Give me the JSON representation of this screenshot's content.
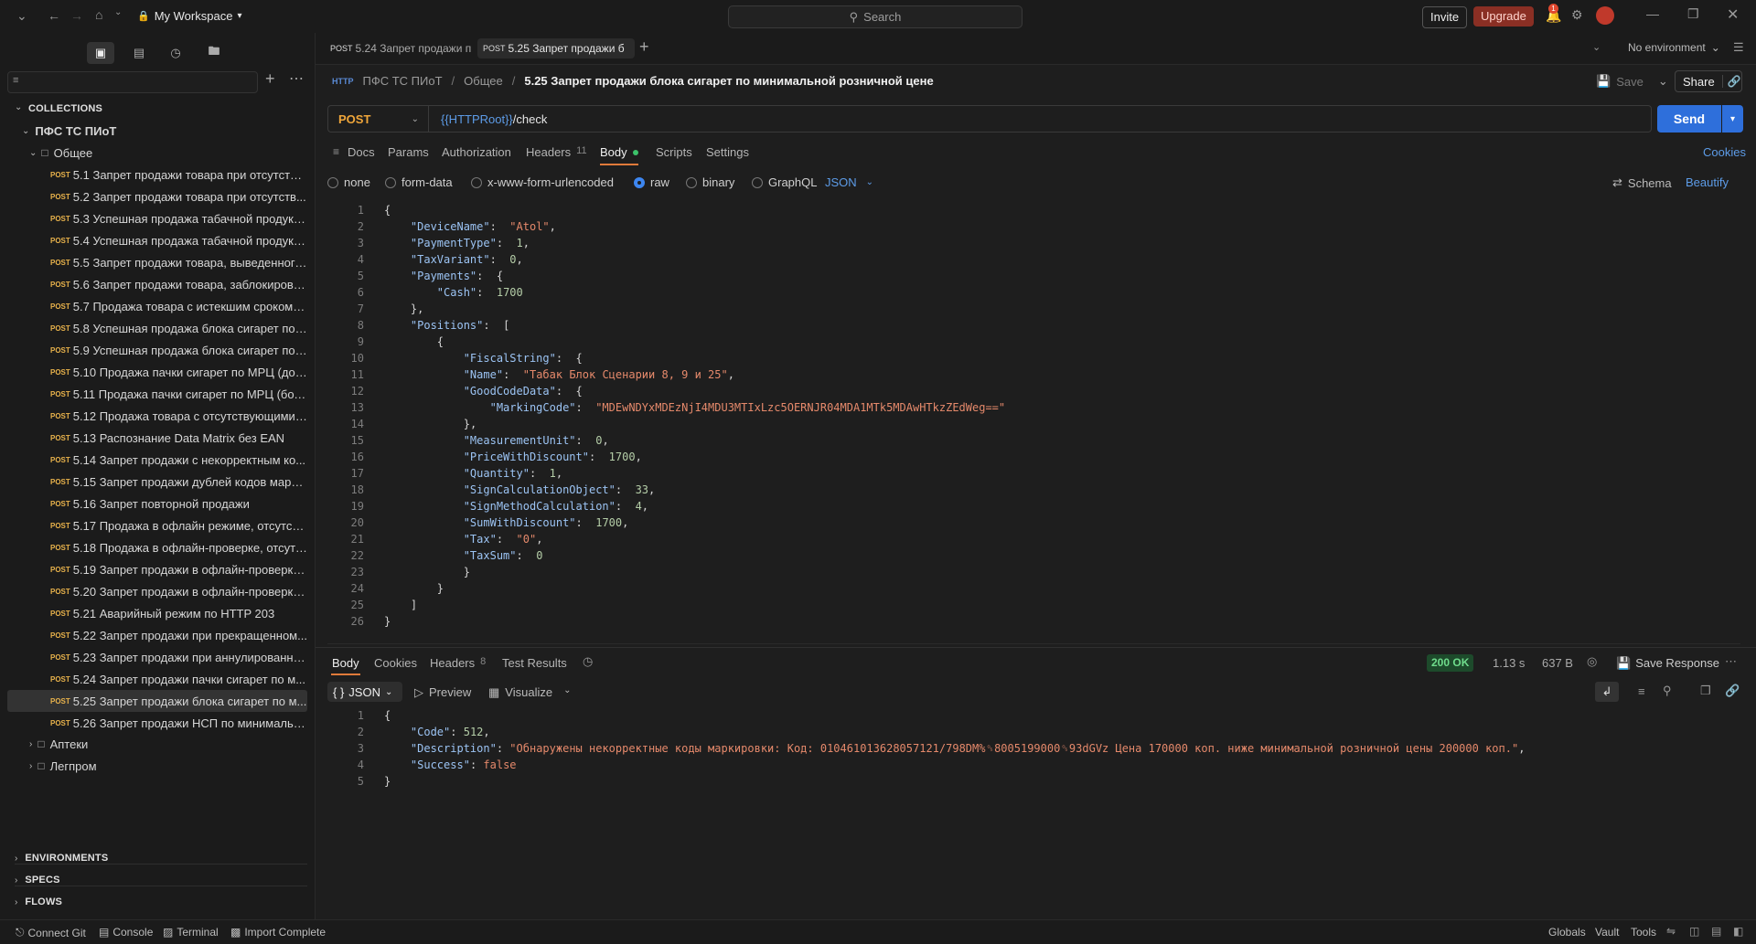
{
  "titlebar": {
    "workspace": "My Workspace",
    "search_placeholder": "Search",
    "invite_label": "Invite",
    "upgrade_label": "Upgrade",
    "notification_count": "1"
  },
  "sidebar": {
    "collections_label": "COLLECTIONS",
    "collection_name": "ПФС ТС ПИоТ",
    "folder_name": "Общее",
    "requests": [
      {
        "method": "POST",
        "name": "5.1 Запрет продажи товара при отсутстви..."
      },
      {
        "method": "POST",
        "name": "5.2 Запрет продажи товара при отсутств..."
      },
      {
        "method": "POST",
        "name": "5.3 Успешная продажа табачной продукц..."
      },
      {
        "method": "POST",
        "name": "5.4 Успешная продажа табачной продукц..."
      },
      {
        "method": "POST",
        "name": "5.5 Запрет продажи товара, выведенного..."
      },
      {
        "method": "POST",
        "name": "5.6 Запрет продажи товара, заблокирова..."
      },
      {
        "method": "POST",
        "name": "5.7 Продажа товара с истекшим сроком г..."
      },
      {
        "method": "POST",
        "name": "5.8 Успешная продажа блока сигарет по ..."
      },
      {
        "method": "POST",
        "name": "5.9 Успешная продажа блока сигарет по ..."
      },
      {
        "method": "POST",
        "name": "5.10 Продажа пачки сигарет по МРЦ (до 1..."
      },
      {
        "method": "POST",
        "name": "5.11 Продажа пачки сигарет по МРЦ (бол..."
      },
      {
        "method": "POST",
        "name": "5.12 Продажа товара с отсутствующими ..."
      },
      {
        "method": "POST",
        "name": "5.13 Распознание Data Matrix без EAN"
      },
      {
        "method": "POST",
        "name": "5.14 Запрет продажи с некорректным ко..."
      },
      {
        "method": "POST",
        "name": "5.15 Запрет продажи дублей кодов марки..."
      },
      {
        "method": "POST",
        "name": "5.16 Запрет повторной продажи"
      },
      {
        "method": "POST",
        "name": "5.17 Продажа в офлайн режиме, отсутств..."
      },
      {
        "method": "POST",
        "name": "5.18 Продажа в офлайн-проверке, отсутс..."
      },
      {
        "method": "POST",
        "name": "5.19 Запрет продажи в офлайн-проверке,..."
      },
      {
        "method": "POST",
        "name": "5.20 Запрет продажи в офлайн-проверке ..."
      },
      {
        "method": "POST",
        "name": "5.21 Аварийный режим по HTTP 203"
      },
      {
        "method": "POST",
        "name": "5.22 Запрет продажи при прекращенном..."
      },
      {
        "method": "POST",
        "name": "5.23 Запрет продажи при аннулированно..."
      },
      {
        "method": "POST",
        "name": "5.24 Запрет продажи пачки сигарет по м..."
      },
      {
        "method": "POST",
        "name": "5.25 Запрет продажи блока сигарет по м..."
      },
      {
        "method": "POST",
        "name": "5.26 Запрет продажи НСП по минимальн..."
      }
    ],
    "other_folders": [
      "Аптеки",
      "Легпром"
    ],
    "bottom_sections": [
      "ENVIRONMENTS",
      "SPECS",
      "FLOWS"
    ]
  },
  "tabs": [
    {
      "method": "POST",
      "name": "5.24 Запрет продажи п"
    },
    {
      "method": "POST",
      "name": "5.25 Запрет продажи б"
    }
  ],
  "environment": "No environment",
  "breadcrumb": {
    "collection": "ПФС ТС ПИоТ",
    "folder": "Общее",
    "request": "5.25 Запрет продажи блока сигарет по минимальной розничной цене"
  },
  "header_actions": {
    "save": "Save",
    "share": "Share"
  },
  "request": {
    "method": "POST",
    "url_var": "{{HTTPRoot}}",
    "url_path": " /check",
    "send_label": "Send",
    "subtabs": [
      "Docs",
      "Params",
      "Authorization",
      "Headers",
      "Body",
      "Scripts",
      "Settings"
    ],
    "headers_count": "11",
    "cookies_label": "Cookies",
    "body_options": [
      "none",
      "form-data",
      "x-www-form-urlencoded",
      "raw",
      "binary",
      "GraphQL"
    ],
    "body_format": "JSON",
    "schema_label": "Schema",
    "beautify_label": "Beautify"
  },
  "request_body_lines": [
    "{",
    "    \"DeviceName\":  \"Atol\",",
    "    \"PaymentType\":  1,",
    "    \"TaxVariant\":  0,",
    "    \"Payments\":  {",
    "        \"Cash\":  1700",
    "    },",
    "    \"Positions\":  [",
    "        {",
    "            \"FiscalString\":  {",
    "            \"Name\":  \"Табак Блок Сценарии 8, 9 и 25\",",
    "            \"GoodCodeData\":  {",
    "                \"MarkingCode\":  \"MDEwNDYxMDEzNjI4MDU3MTIxLzc5OERNJR04MDA1MTk5MDAwHTkzZEdWeg==\"",
    "            },",
    "            \"MeasurementUnit\":  0,",
    "            \"PriceWithDiscount\":  1700,",
    "            \"Quantity\":  1,",
    "            \"SignCalculationObject\":  33,",
    "            \"SignMethodCalculation\":  4,",
    "            \"SumWithDiscount\":  1700,",
    "            \"Tax\":  \"0\",",
    "            \"TaxSum\":  0",
    "            }",
    "        }",
    "    ]",
    "}"
  ],
  "response": {
    "tabs": [
      "Body",
      "Cookies",
      "Headers",
      "Test Results"
    ],
    "headers_count": "8",
    "status": "200 OK",
    "time": "1.13 s",
    "size": "637 B",
    "save_response": "Save Response",
    "format": "JSON",
    "preview": "Preview",
    "visualize": "Visualize",
    "lines": [
      "{",
      "    \"Code\": 512,",
      "    \"Description\": \"Обнаружены некорректные коды маркировки: Код: 010461013628057121/798DM%␝8005199000␝93dGVz Цена 170000 коп. ниже минимальной розничной цены 200000 коп.\",",
      "    \"Success\": false",
      "}"
    ]
  },
  "footer": {
    "left": [
      "Connect Git",
      "Console",
      "Terminal",
      "Import Complete"
    ],
    "right": [
      "Globals",
      "Vault",
      "Tools"
    ]
  },
  "colors": {
    "accent": "#2e6fdb",
    "post": "#e8b24b",
    "upgrade": "#8a2f24",
    "status_ok": "#6fdc8c"
  }
}
